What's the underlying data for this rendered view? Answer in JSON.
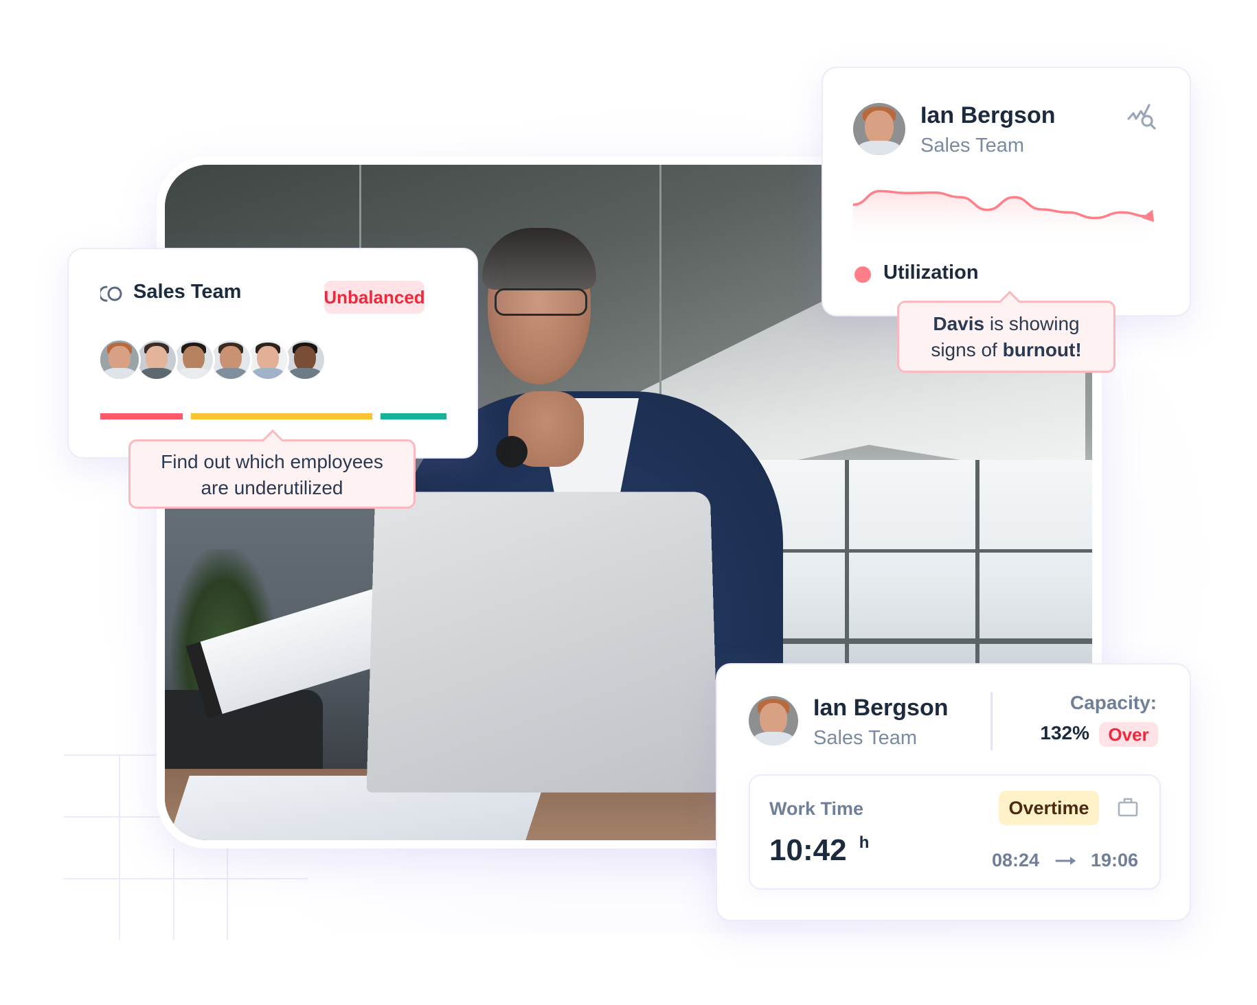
{
  "team_card": {
    "icon": "team-cycle-icon",
    "title": "Sales Team",
    "status_badge": "Unbalanced",
    "members": [
      {
        "name": "member-1",
        "skin": "#d9a184",
        "hair": "#b86a3c",
        "shirt": "#dfe4ea",
        "bg": "#9aa3a8"
      },
      {
        "name": "member-2",
        "skin": "#e3b39a",
        "hair": "#3a2c25",
        "shirt": "#5c6770",
        "bg": "#c7cdd2"
      },
      {
        "name": "member-3",
        "skin": "#b6825f",
        "hair": "#1f1a17",
        "shirt": "#e8ecef",
        "bg": "#dfe3e6"
      },
      {
        "name": "member-4",
        "skin": "#c99273",
        "hair": "#3b2a20",
        "shirt": "#7f8f9e",
        "bg": "#e3e6ea"
      },
      {
        "name": "member-5",
        "skin": "#e1b096",
        "hair": "#2e221c",
        "shirt": "#9fb2c7",
        "bg": "#eef0f2"
      },
      {
        "name": "member-6",
        "skin": "#7a4e36",
        "hair": "#1b1512",
        "shirt": "#6e7c88",
        "bg": "#d5d9dd"
      }
    ],
    "distribution": [
      {
        "label": "overutilized",
        "share": 0.25,
        "color": "#ff5a6a"
      },
      {
        "label": "balanced",
        "share": 0.55,
        "color": "#fbc232"
      },
      {
        "label": "underutilized",
        "share": 0.2,
        "color": "#16b29a"
      }
    ],
    "tooltip": {
      "line1": "Find out which employees",
      "line2": "are underutilized"
    }
  },
  "utilization_card": {
    "name": "Ian Bergson",
    "team": "Sales Team",
    "action_icon": "chart-search-icon",
    "legend_label": "Utilization",
    "legend_color": "#ff7e88",
    "trend_values": [
      55,
      82,
      78,
      79,
      70,
      45,
      70,
      46,
      40,
      29,
      40,
      32
    ],
    "tooltip": {
      "bold_name": "Davis",
      "text_mid": " is showing",
      "text_pre": "signs of ",
      "bold_word": "burnout!"
    }
  },
  "capacity_card": {
    "name": "Ian Bergson",
    "team": "Sales Team",
    "capacity_label": "Capacity:",
    "capacity_value": "132%",
    "capacity_badge": "Over",
    "work_time": {
      "label": "Work Time",
      "badge": "Overtime",
      "icon": "briefcase-icon",
      "value": "10:42",
      "unit": "h",
      "start": "08:24",
      "end": "19:06",
      "arrow_icon": "arrow-right-icon"
    }
  },
  "colors": {
    "danger": "#f0283c",
    "danger_bg": "#ffe3e6",
    "warning_bg": "#fff2c8",
    "warning_text": "#4a2a12",
    "muted": "#7a8aa2",
    "text": "#1c2a3e"
  }
}
